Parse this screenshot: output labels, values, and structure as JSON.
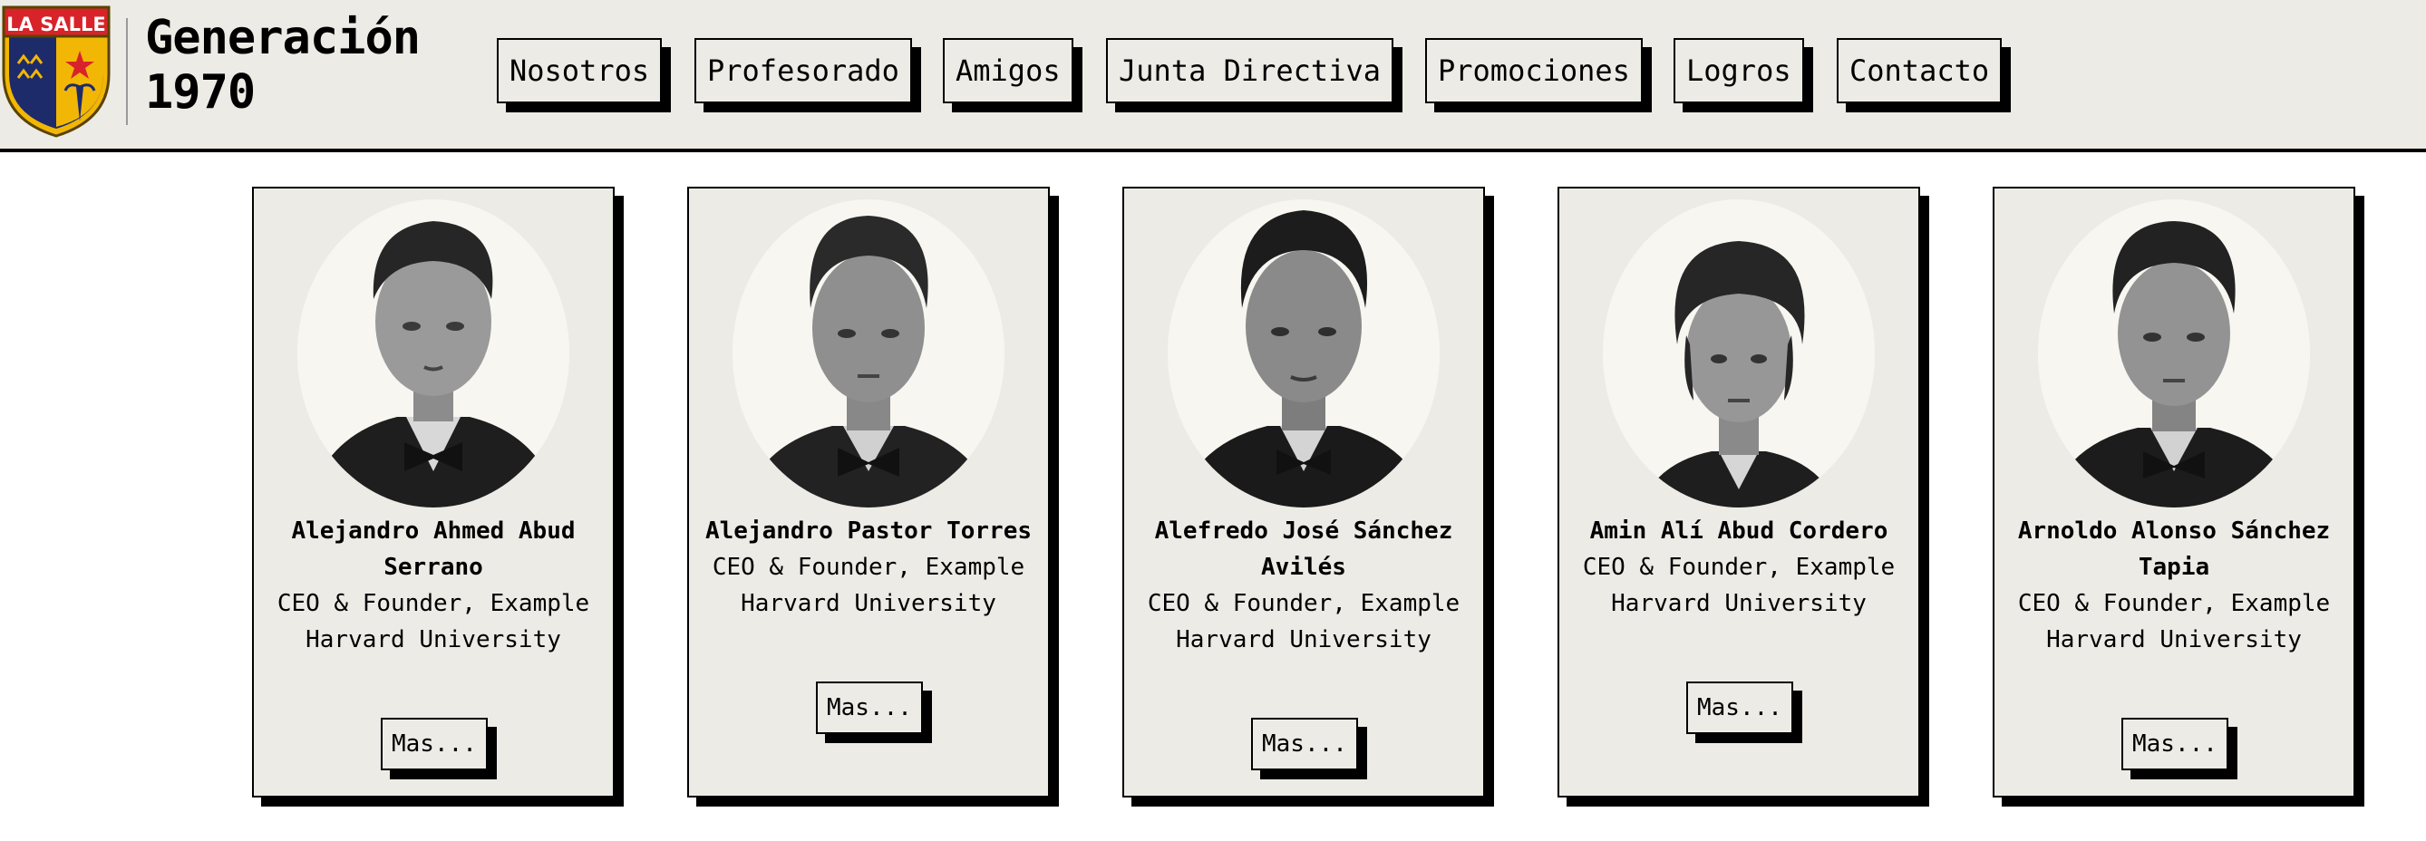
{
  "header": {
    "logo_text": "LA SALLE",
    "title_line1": "Generación",
    "title_line2": "1970",
    "nav": [
      {
        "label": "Nosotros"
      },
      {
        "label": "Profesorado"
      },
      {
        "label": "Amigos"
      },
      {
        "label": "Junta Directiva"
      },
      {
        "label": "Promociones"
      },
      {
        "label": "Logros"
      },
      {
        "label": "Contacto"
      }
    ]
  },
  "colors": {
    "background": "#ecebe6",
    "logo_red": "#d8232a",
    "logo_blue": "#1d2b6b",
    "logo_gold": "#f2b705"
  },
  "cards": [
    {
      "name": "Alejandro Ahmed Abud Serrano",
      "role": "CEO & Founder, Example",
      "school": "Harvard University",
      "button": "Mas..."
    },
    {
      "name": "Alejandro Pastor Torres",
      "role": "CEO & Founder, Example",
      "school": "Harvard University",
      "button": "Mas..."
    },
    {
      "name": "Alefredo José Sánchez Avilés",
      "role": "CEO & Founder, Example",
      "school": "Harvard University",
      "button": "Mas..."
    },
    {
      "name": "Amin Alí Abud Cordero",
      "role": "CEO & Founder, Example",
      "school": "Harvard University",
      "button": "Mas..."
    },
    {
      "name": "Arnoldo Alonso Sánchez Tapia",
      "role": "CEO & Founder, Example",
      "school": "Harvard University",
      "button": "Mas..."
    }
  ]
}
